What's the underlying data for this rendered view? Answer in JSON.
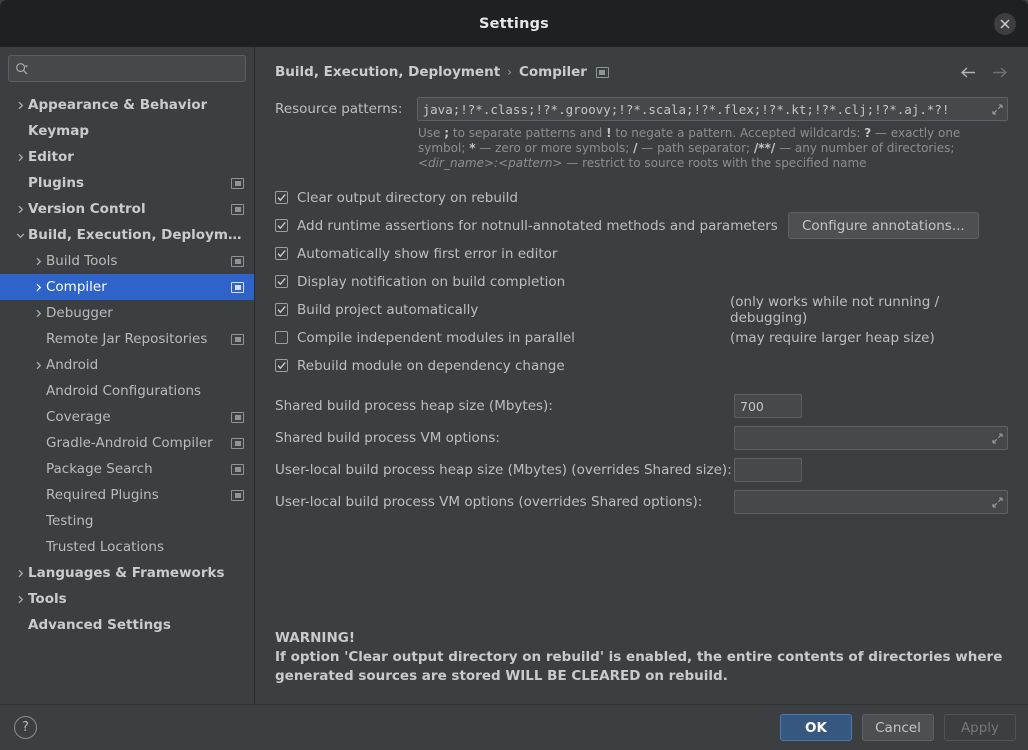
{
  "window": {
    "title": "Settings",
    "close_icon": "close-icon"
  },
  "sidebar": {
    "search": {
      "placeholder": "",
      "value": "",
      "icon": "search-icon"
    },
    "items": [
      {
        "label": "Appearance & Behavior",
        "level": 0,
        "arrow": "right",
        "top": true,
        "badge": false
      },
      {
        "label": "Keymap",
        "level": 0,
        "arrow": "none",
        "top": true,
        "badge": false
      },
      {
        "label": "Editor",
        "level": 0,
        "arrow": "right",
        "top": true,
        "badge": false
      },
      {
        "label": "Plugins",
        "level": 0,
        "arrow": "none",
        "top": true,
        "badge": true
      },
      {
        "label": "Version Control",
        "level": 0,
        "arrow": "right",
        "top": true,
        "badge": true
      },
      {
        "label": "Build, Execution, Deployment",
        "level": 0,
        "arrow": "down",
        "top": true,
        "badge": false
      },
      {
        "label": "Build Tools",
        "level": 1,
        "arrow": "right",
        "top": false,
        "badge": true
      },
      {
        "label": "Compiler",
        "level": 1,
        "arrow": "right",
        "top": false,
        "badge": true,
        "selected": true
      },
      {
        "label": "Debugger",
        "level": 1,
        "arrow": "right",
        "top": false,
        "badge": false
      },
      {
        "label": "Remote Jar Repositories",
        "level": 1,
        "arrow": "none",
        "top": false,
        "badge": true
      },
      {
        "label": "Android",
        "level": 1,
        "arrow": "right",
        "top": false,
        "badge": false
      },
      {
        "label": "Android Configurations",
        "level": 1,
        "arrow": "none",
        "top": false,
        "badge": false
      },
      {
        "label": "Coverage",
        "level": 1,
        "arrow": "none",
        "top": false,
        "badge": true
      },
      {
        "label": "Gradle-Android Compiler",
        "level": 1,
        "arrow": "none",
        "top": false,
        "badge": true
      },
      {
        "label": "Package Search",
        "level": 1,
        "arrow": "none",
        "top": false,
        "badge": true
      },
      {
        "label": "Required Plugins",
        "level": 1,
        "arrow": "none",
        "top": false,
        "badge": true
      },
      {
        "label": "Testing",
        "level": 1,
        "arrow": "none",
        "top": false,
        "badge": false
      },
      {
        "label": "Trusted Locations",
        "level": 1,
        "arrow": "none",
        "top": false,
        "badge": false
      },
      {
        "label": "Languages & Frameworks",
        "level": 0,
        "arrow": "right",
        "top": true,
        "badge": false
      },
      {
        "label": "Tools",
        "level": 0,
        "arrow": "right",
        "top": true,
        "badge": false
      },
      {
        "label": "Advanced Settings",
        "level": 0,
        "arrow": "none",
        "top": true,
        "badge": false
      }
    ]
  },
  "content": {
    "breadcrumb": {
      "parent": "Build, Execution, Deployment",
      "separator": "›",
      "current": "Compiler",
      "badge_icon": "project-scope-icon"
    },
    "nav": {
      "back_icon": "arrow-left-icon",
      "forward_icon": "arrow-right-icon"
    },
    "resource_patterns": {
      "label": "Resource patterns:",
      "value": "!?*.java;!?*.class;!?*.groovy;!?*.scala;!?*.flex;!?*.kt;!?*.clj;!?*.aj",
      "expand_icon": "expand-icon"
    },
    "hint": {
      "line1_a": "Use ",
      "line1_b": ";",
      "line1_c": " to separate patterns and ",
      "line1_d": "!",
      "line1_e": " to negate a pattern. Accepted wildcards: ",
      "line1_f": "?",
      "line1_g": " — exactly one symbol; ",
      "line1_h": "*",
      "line1_i": " — zero or more symbols; ",
      "line1_j": "/",
      "line1_k": " — path separator; ",
      "line1_l": "/**/",
      "line1_m": " — any number of directories; ",
      "line1_n": "<dir_name>:<pattern>",
      "line1_o": " — restrict to source roots with the specified name"
    },
    "checkboxes": [
      {
        "label": "Clear output directory on rebuild",
        "checked": true,
        "mnemonic": "l",
        "note": "",
        "button": ""
      },
      {
        "label": "Add runtime assertions for notnull-annotated methods and parameters",
        "checked": true,
        "mnemonic": "a",
        "note": "",
        "button": "Configure annotations..."
      },
      {
        "label": "Automatically show first error in editor",
        "checked": true,
        "mnemonic": "e",
        "note": "",
        "button": ""
      },
      {
        "label": "Display notification on build completion",
        "checked": true,
        "mnemonic": "",
        "note": "",
        "button": ""
      },
      {
        "label": "Build project automatically",
        "checked": true,
        "mnemonic": "",
        "note": "(only works while not running / debugging)",
        "button": ""
      },
      {
        "label": "Compile independent modules in parallel",
        "checked": false,
        "mnemonic": "",
        "note": "(may require larger heap size)",
        "button": ""
      },
      {
        "label": "Rebuild module on dependency change",
        "checked": true,
        "mnemonic": "",
        "note": "",
        "button": ""
      }
    ],
    "fields": [
      {
        "label": "Shared build process heap size (Mbytes):",
        "value": "700",
        "kind": "small",
        "expand": false
      },
      {
        "label": "Shared build process VM options:",
        "value": "",
        "kind": "wide",
        "expand": true
      },
      {
        "label": "User-local build process heap size (Mbytes) (overrides Shared size):",
        "value": "",
        "kind": "small",
        "expand": false
      },
      {
        "label": "User-local build process VM options (overrides Shared options):",
        "value": "",
        "kind": "wide",
        "expand": true
      }
    ],
    "warning": {
      "line1": "WARNING!",
      "line2": "If option 'Clear output directory on rebuild' is enabled, the entire contents of directories where",
      "line3": "generated sources are stored WILL BE CLEARED on rebuild."
    }
  },
  "footer": {
    "help_label": "?",
    "ok_label": "OK",
    "cancel_label": "Cancel",
    "apply_label": "Apply"
  },
  "colors": {
    "accent_selection": "#2f63c9",
    "ok_button": "#365880",
    "dialog_bg": "#3c3f41",
    "titlebar_bg": "#1f2022",
    "field_bg": "#45494a"
  }
}
